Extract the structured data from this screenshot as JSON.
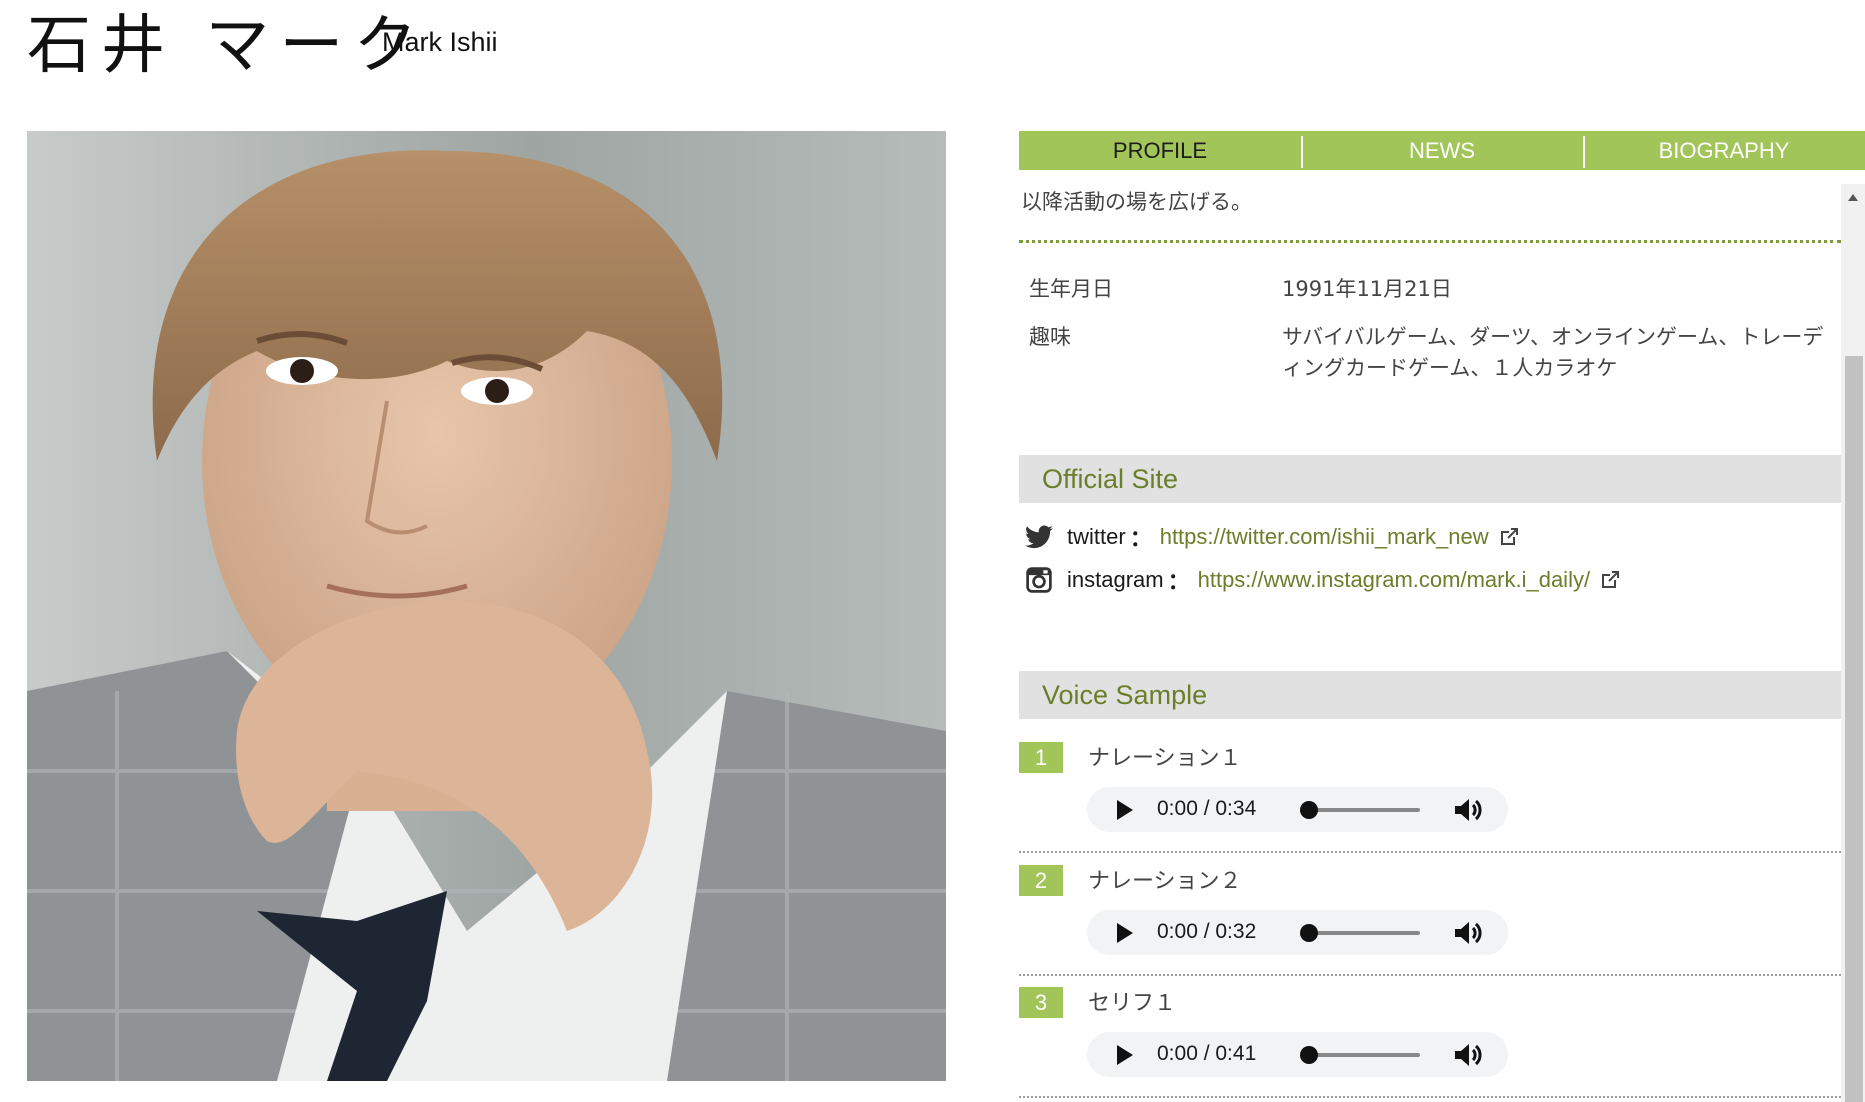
{
  "header": {
    "name_ja": "石井 マーク",
    "name_en": "Mark Ishii"
  },
  "tabs": [
    {
      "label": "PROFILE",
      "active": true
    },
    {
      "label": "NEWS",
      "active": false
    },
    {
      "label": "BIOGRAPHY",
      "active": false
    }
  ],
  "profile": {
    "intro_tail": "以降活動の場を広げる。",
    "rows": [
      {
        "key": "生年月日",
        "value": "1991年11月21日"
      },
      {
        "key": "趣味",
        "value": "サバイバルゲーム、ダーツ、オンラインゲーム、トレーディングカードゲーム、１人カラオケ"
      }
    ]
  },
  "official_site": {
    "heading": "Official Site",
    "links": [
      {
        "icon": "twitter-icon",
        "label": "twitter",
        "colon": "：",
        "url": "https://twitter.com/ishii_mark_new"
      },
      {
        "icon": "instagram-icon",
        "label": "instagram",
        "colon": "：",
        "url": "https://www.instagram.com/mark.i_daily/"
      }
    ]
  },
  "voice_sample": {
    "heading": "Voice Sample",
    "items": [
      {
        "num": "1",
        "title": "ナレーション１",
        "time": "0:00 / 0:34"
      },
      {
        "num": "2",
        "title": "ナレーション２",
        "time": "0:00 / 0:32"
      },
      {
        "num": "3",
        "title": "セリフ１",
        "time": "0:00 / 0:41"
      }
    ]
  },
  "colors": {
    "accent_green": "#a2c55a",
    "link_green": "#6a7f2a",
    "section_bg": "#e1e1e1"
  }
}
